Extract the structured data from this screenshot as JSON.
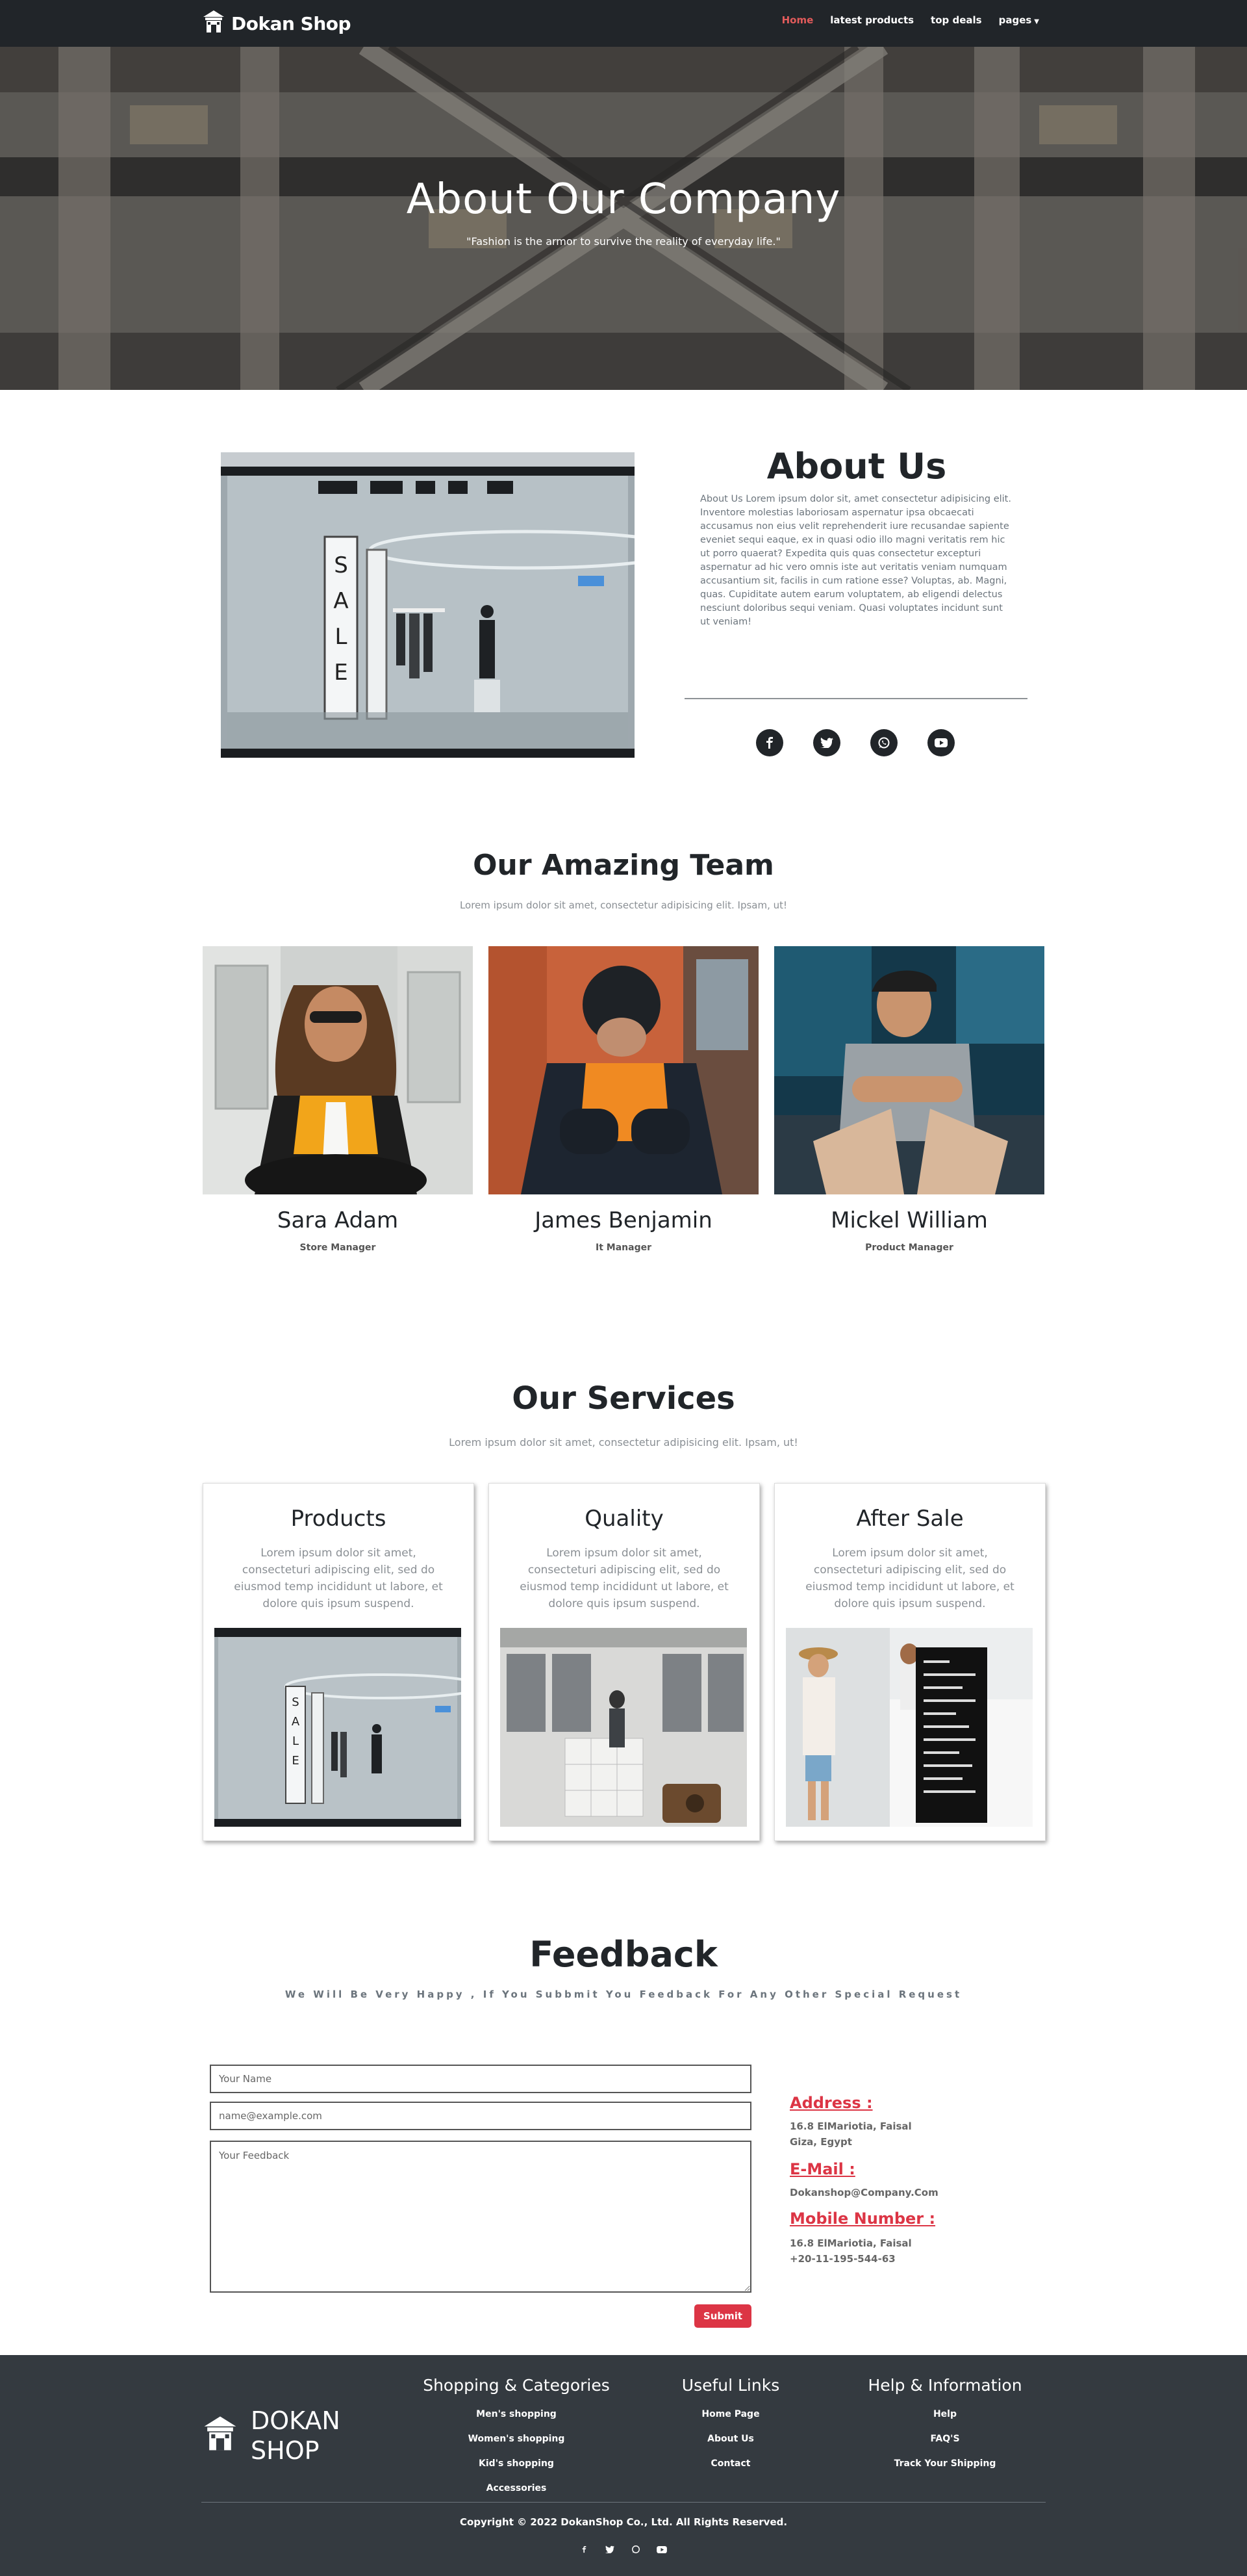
{
  "navbar": {
    "brand": "Dokan Shop",
    "links": [
      {
        "label": "Home",
        "active": true
      },
      {
        "label": "latest products"
      },
      {
        "label": "top deals"
      },
      {
        "label": "pages"
      }
    ],
    "active_color": "#e25b5b"
  },
  "hero": {
    "title": "About Our Company",
    "subtitle": "\"Fashion is the armor to survive the reality of everyday life.\""
  },
  "about": {
    "title": "About Us",
    "text": "About Us Lorem ipsum dolor sit, amet consectetur adipisicing elit. Inventore molestias laboriosam aspernatur ipsa obcaecati accusamus non eius velit reprehenderit iure recusandae sapiente eveniet sequi eaque, ex in quasi odio illo magni veritatis rem hic ut porro quaerat? Expedita quis quas consectetur excepturi aspernatur ad hic vero omnis iste aut veritatis veniam numquam accusantium sit, facilis in cum ratione esse? Voluptas, ab. Magni, quas. Cupiditate autem earum voluptatem, ab eligendi delectus nesciunt doloribus sequi veniam. Quasi voluptates incidunt sunt ut veniam!",
    "image_sign": "SALE",
    "socials": [
      "facebook-icon",
      "twitter-icon",
      "whatsapp-icon",
      "youtube-icon"
    ]
  },
  "team": {
    "title": "Our Amazing Team",
    "subtitle": "Lorem ipsum dolor sit amet, consectetur adipisicing elit. Ipsam, ut!",
    "members": [
      {
        "name": "Sara Adam",
        "role": "Store Manager"
      },
      {
        "name": "James Benjamin",
        "role": "It Manager"
      },
      {
        "name": "Mickel William",
        "role": "Product Manager"
      }
    ]
  },
  "services": {
    "title": "Our Services",
    "subtitle": "Lorem ipsum dolor sit amet, consectetur adipisicing elit. Ipsam, ut!",
    "items": [
      {
        "title": "Products",
        "text": "Lorem ipsum dolor sit amet, consecteturi adipiscing elit, sed do eiusmod temp incididunt ut labore, et dolore quis ipsum suspend."
      },
      {
        "title": "Quality",
        "text": "Lorem ipsum dolor sit amet, consecteturi adipiscing elit, sed do eiusmod temp incididunt ut labore, et dolore quis ipsum suspend."
      },
      {
        "title": "After Sale",
        "text": "Lorem ipsum dolor sit amet, consecteturi adipiscing elit, sed do eiusmod temp incididunt ut labore, et dolore quis ipsum suspend."
      }
    ]
  },
  "feedback": {
    "title": "Feedback",
    "subtitle": "We Will Be Very Happy , If You Subbmit You Feedback For Any Other Special Request",
    "name_placeholder": "Your Name",
    "email_placeholder": "name@example.com",
    "feedback_placeholder": "Your Feedback",
    "submit_label": "Submit",
    "accent_color": "#dc3545",
    "contact": {
      "address_label": "Address :",
      "address": "16.8 ElMariotia, Faisal Giza, Egypt",
      "email_label": "E-Mail :",
      "email": "Dokanshop@Company.Com",
      "mobile_label": "Mobile Number :",
      "mobile_line1": "16.8 ElMariotia, Faisal",
      "mobile_line2": "+20-11-195-544-63"
    }
  },
  "footer": {
    "logo_line1": "DOKAN",
    "logo_line2": "SHOP",
    "columns": [
      {
        "title": "Shopping & Categories",
        "links": [
          "Men's shopping",
          "Women's shopping",
          "Kid's shopping",
          "Accessories"
        ]
      },
      {
        "title": "Useful Links",
        "links": [
          "Home Page",
          "About Us",
          "Contact"
        ]
      },
      {
        "title": "Help & Information",
        "links": [
          "Help",
          "FAQ'S",
          "Track Your Shipping"
        ]
      }
    ],
    "copyright": "Copyright © 2022 DokanShop Co., Ltd. All Rights Reserved.",
    "socials": [
      "facebook-icon",
      "twitter-icon",
      "whatsapp-icon",
      "youtube-icon"
    ]
  }
}
